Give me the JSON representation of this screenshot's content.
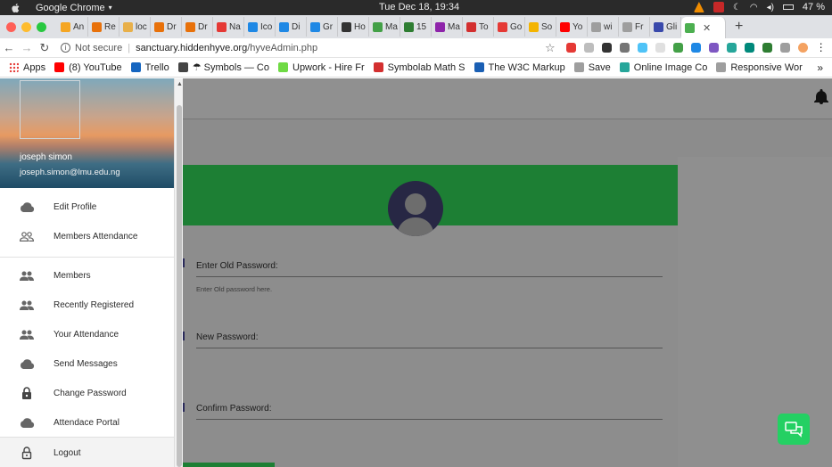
{
  "os": {
    "app_name": "Google Chrome",
    "clock": "Tue Dec 18, 19:34",
    "battery": "47 %"
  },
  "tabs": [
    {
      "label": "An",
      "color": "#f5a623"
    },
    {
      "label": "Re",
      "color": "#e8710a"
    },
    {
      "label": "loc",
      "color": "#e8b04a"
    },
    {
      "label": "Dr",
      "color": "#e8710a"
    },
    {
      "label": "Dr",
      "color": "#e8710a"
    },
    {
      "label": "Na",
      "color": "#e53935"
    },
    {
      "label": "Ico",
      "color": "#1e88e5"
    },
    {
      "label": "Di",
      "color": "#1e88e5"
    },
    {
      "label": "Gr",
      "color": "#1e88e5"
    },
    {
      "label": "Ho",
      "color": "#333333"
    },
    {
      "label": "Ma",
      "color": "#43a047"
    },
    {
      "label": "15",
      "color": "#2e7d32"
    },
    {
      "label": "Ma",
      "color": "#8e24aa"
    },
    {
      "label": "To",
      "color": "#d32f2f"
    },
    {
      "label": "Go",
      "color": "#e53935"
    },
    {
      "label": "So",
      "color": "#f4b400"
    },
    {
      "label": "Yo",
      "color": "#ff0000"
    },
    {
      "label": "wi",
      "color": "#9e9e9e"
    },
    {
      "label": "Fr",
      "color": "#9e9e9e"
    },
    {
      "label": "Gli",
      "color": "#3949ab"
    },
    {
      "label": "",
      "color": "#4caf50",
      "active": true
    }
  ],
  "address": {
    "security": "Not secure",
    "host": "sanctuary.hiddenhyve.org",
    "path": "/hyveAdmin.php"
  },
  "bookmarks": [
    {
      "label": "Apps",
      "color": "#e53935"
    },
    {
      "label": "(8) YouTube",
      "color": "#ff0000"
    },
    {
      "label": "Trello",
      "color": "#1565c0"
    },
    {
      "label": "☂ Symbols — Co",
      "color": "#444444"
    },
    {
      "label": "Upwork - Hire Fr",
      "color": "#6fda44"
    },
    {
      "label": "Symbolab Math S",
      "color": "#d32f2f"
    },
    {
      "label": "The W3C Markup",
      "color": "#1a5fb4"
    },
    {
      "label": "Save",
      "color": "#9e9e9e"
    },
    {
      "label": "Online Image Co",
      "color": "#26a69a"
    },
    {
      "label": "Responsive Wor",
      "color": "#9e9e9e"
    }
  ],
  "drawer": {
    "user_name": "joseph simon",
    "user_email": "joseph.simon@lmu.edu.ng",
    "group1": [
      {
        "label": "Edit Profile",
        "icon": "cloud-icon"
      },
      {
        "label": "Members Attendance",
        "icon": "people-outline-icon"
      }
    ],
    "group2": [
      {
        "label": "Members",
        "icon": "people-icon"
      },
      {
        "label": "Recently Registered",
        "icon": "people-icon"
      },
      {
        "label": "Your Attendance",
        "icon": "people-icon"
      },
      {
        "label": "Send Messages",
        "icon": "cloud-icon"
      },
      {
        "label": "Change Password",
        "icon": "lock-icon"
      },
      {
        "label": "Attendace Portal",
        "icon": "cloud-icon"
      }
    ],
    "logout": {
      "label": "Logout",
      "icon": "lock-outline-icon"
    }
  },
  "form": {
    "old_password_label": "Enter Old Password:",
    "old_password_hint": "Enter Old password here.",
    "new_password_label": "New Password:",
    "confirm_password_label": "Confirm Password:"
  },
  "colors": {
    "accent_green": "#28a745",
    "fab_green": "#24d063"
  }
}
